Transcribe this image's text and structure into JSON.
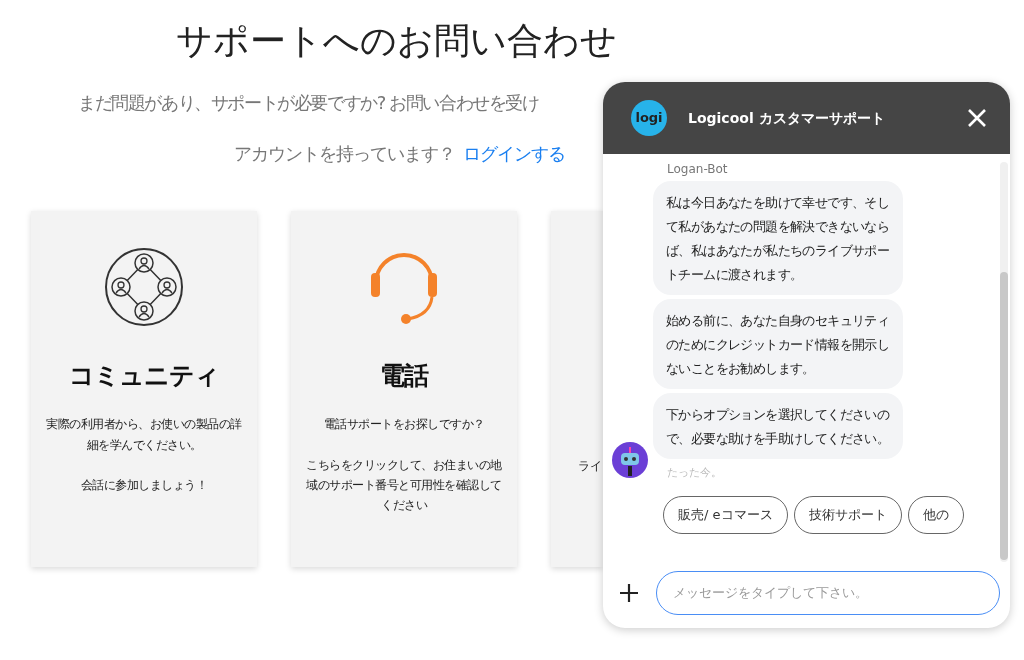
{
  "page": {
    "title": "サポートへのお問い合わせ",
    "subtitle": "まだ問題があり、サポートが必要ですか? お問い合わせを受け",
    "account_prompt": "アカウントを持っています？",
    "login_link": "ログインする"
  },
  "cards": [
    {
      "kind": "community",
      "title": "コミュニティ",
      "paragraphs": [
        "実際の利用者から、お使いの製品の詳細を学んでください。",
        "会話に参加しましょう！"
      ]
    },
    {
      "kind": "phone",
      "title": "電話",
      "paragraphs": [
        "電話サポートをお探しですか？",
        "こちらをクリックして、お住まいの地域のサポート番号と可用性を確認してください"
      ]
    },
    {
      "kind": "partial",
      "paragraphs": [
        "ライ"
      ]
    }
  ],
  "chat": {
    "logo_text": "logi",
    "title": "Logicool カスタマーサポート",
    "sender": "Logan-Bot",
    "messages": [
      "私は今日あなたを助けて幸せです、そして私があなたの問題を解決できないならば、私はあなたが私たちのライブサポートチームに渡されます。",
      "始める前に、あなた自身のセキュリティのためにクレジットカード情報を開示しないことをお勧めします。",
      "下からオプションを選択してくださいので、必要な助けを手助けしてください。"
    ],
    "timestamp": "たった今。",
    "quick_replies": [
      "販売/ eコマース",
      "技術サポート",
      "他の"
    ],
    "input_placeholder": "メッセージをタイプして下さい。"
  }
}
